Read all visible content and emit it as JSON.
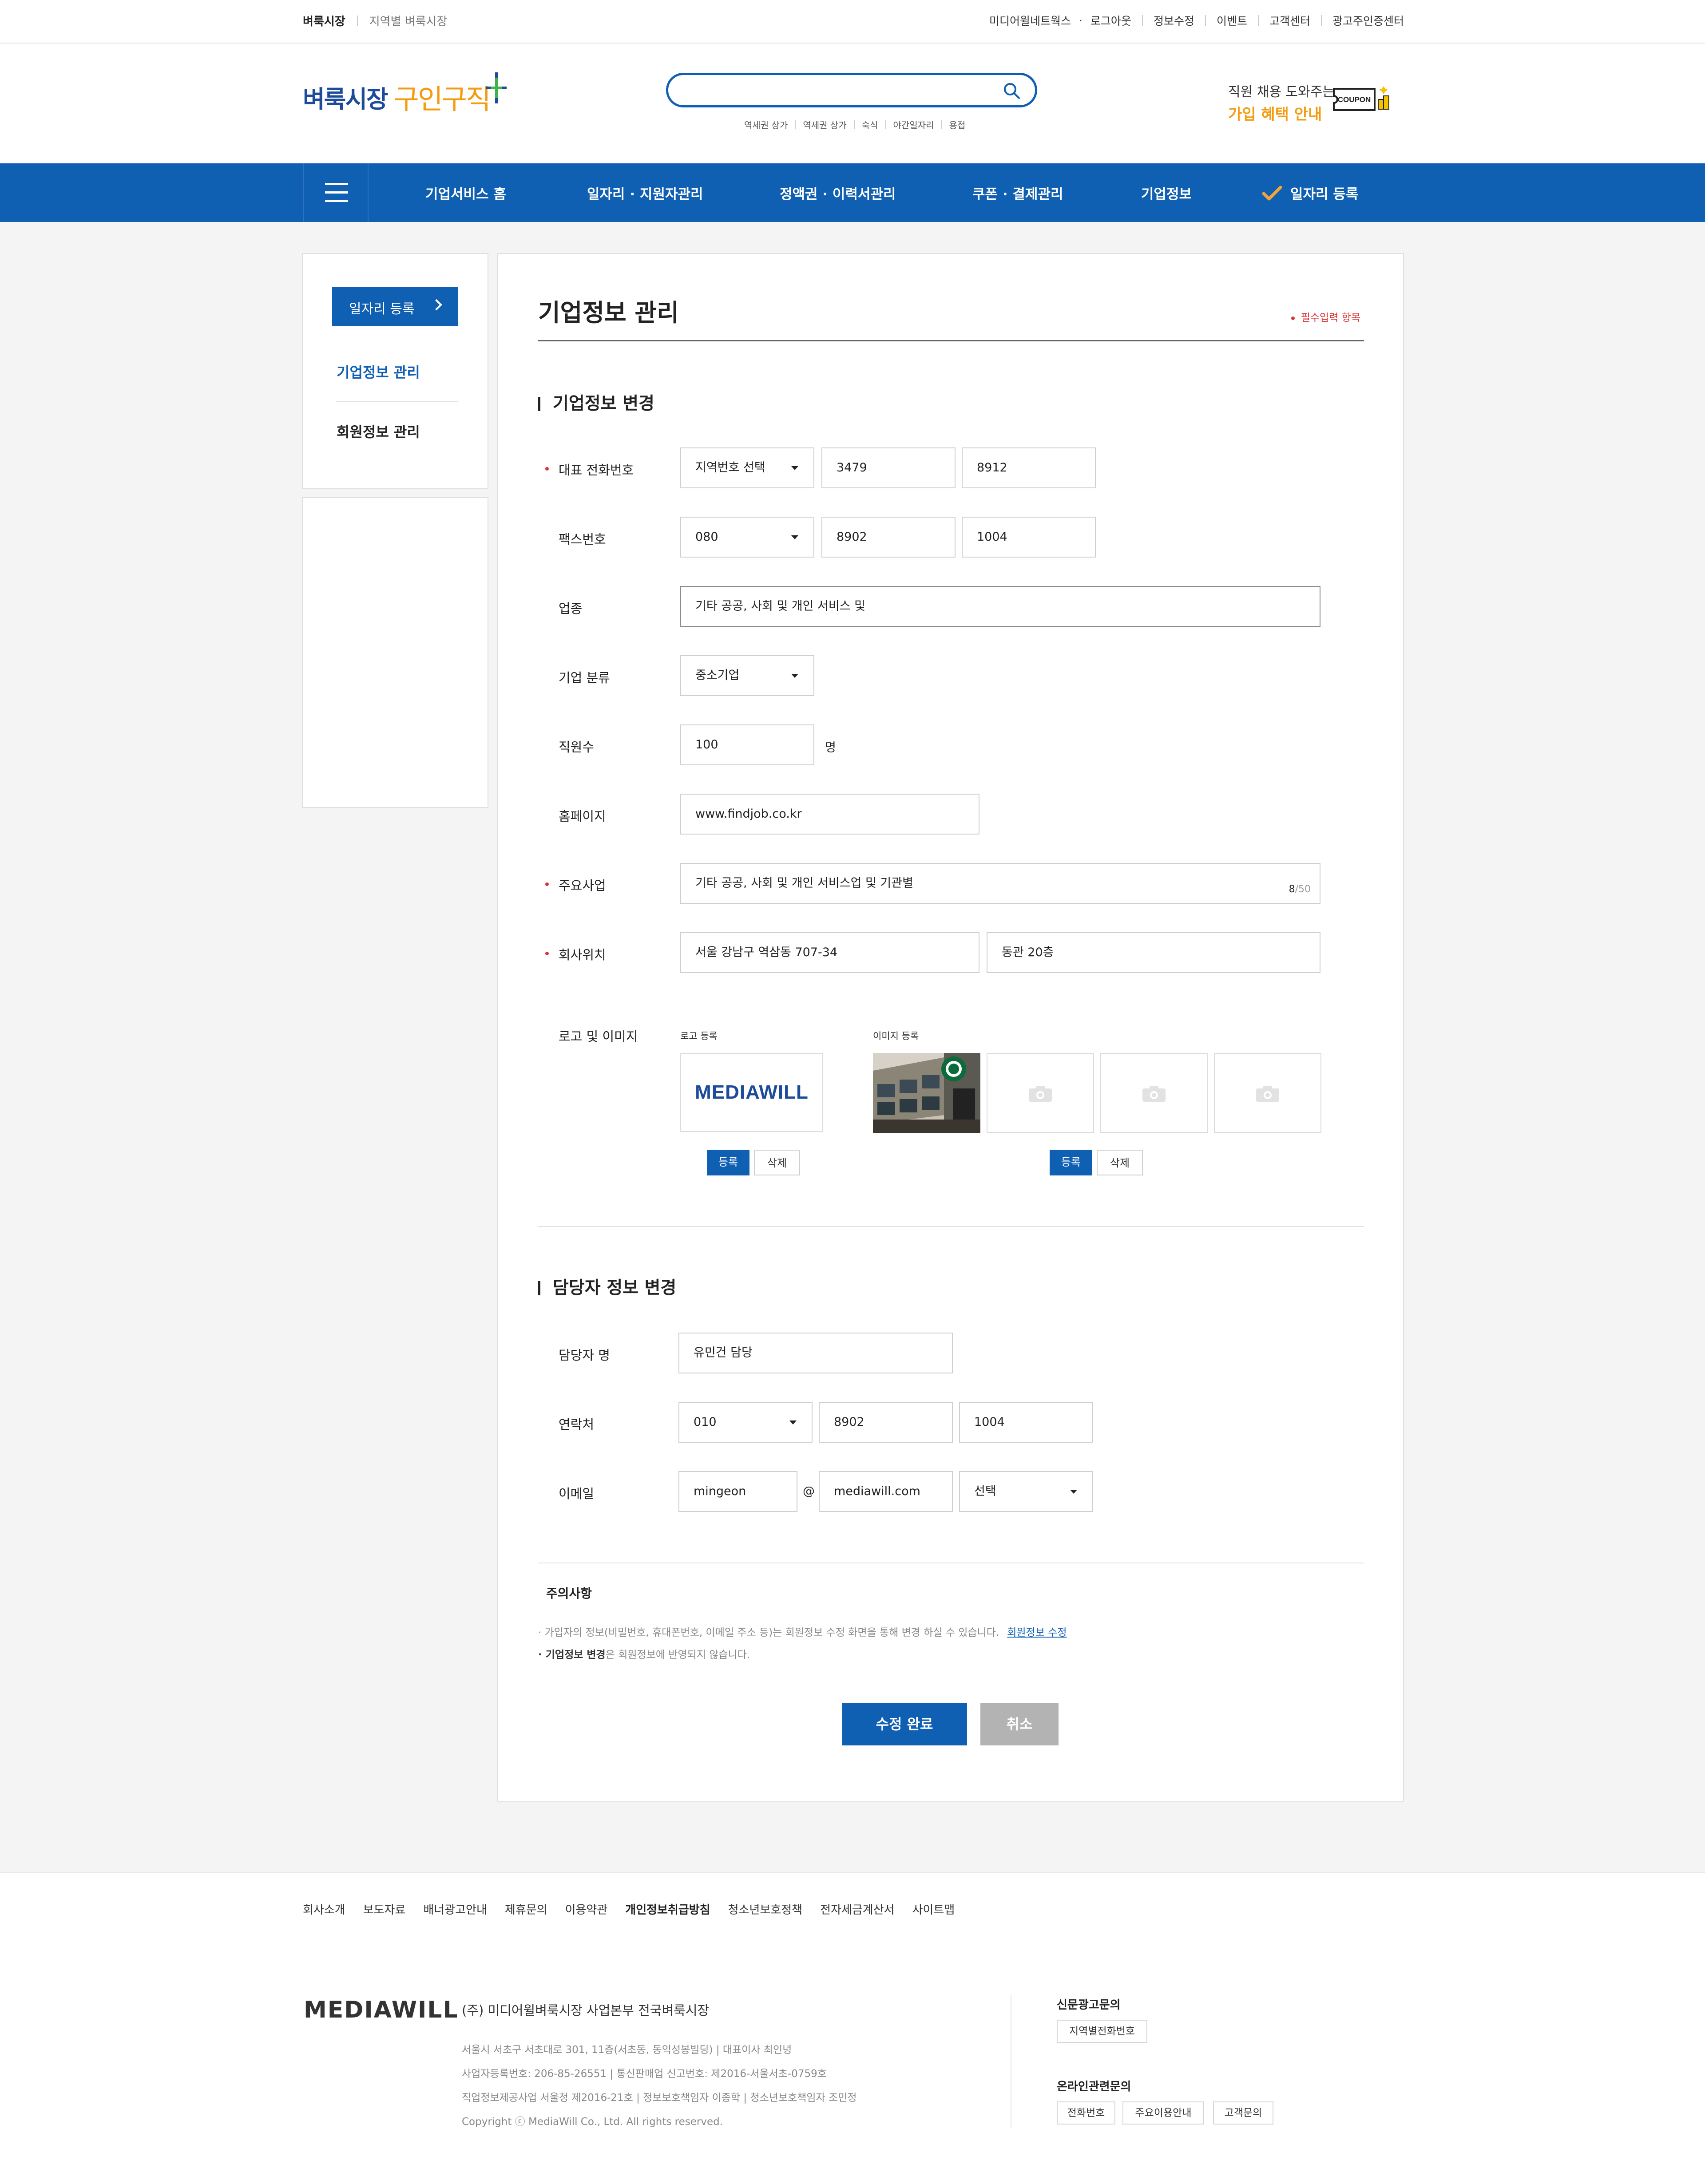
{
  "topbar": {
    "current": "벼룩시장",
    "regional": "지역별 벼룩시장",
    "links": [
      "미디어윌네트웍스",
      "로그아웃",
      "정보수정",
      "이벤트",
      "고객센터",
      "광고주인증센터"
    ]
  },
  "header": {
    "logo_main": "벼룩시장",
    "logo_sub": "구인구직",
    "search_placeholder": "",
    "keywords": [
      "역세권 상가",
      "역세권 상가",
      "숙식",
      "야간일자리",
      "용접"
    ],
    "promo_line1": "직원 채용 도와주는",
    "promo_line2": "가입 혜택 안내",
    "coupon_label": "COUPON"
  },
  "nav": {
    "items": [
      "기업서비스 홈",
      "일자리 · 지원자관리",
      "정액권 · 이력서관리",
      "쿠폰 · 결제관리",
      "기업정보",
      "일자리 등록"
    ]
  },
  "sidebar": {
    "register_button": "일자리 등록",
    "items": [
      "기업정보 관리",
      "회원정보 관리"
    ]
  },
  "page": {
    "title": "기업정보 관리",
    "required_note": "필수입력 항목"
  },
  "company_section": {
    "title": "기업정보 변경",
    "phone_label": "대표 전화번호",
    "phone": [
      "지역번호 선택",
      "3479",
      "8912"
    ],
    "fax_label": "팩스번호",
    "fax": [
      "080",
      "8902",
      "1004"
    ],
    "industry_label": "업종",
    "industry": "기타 공공, 사회 및 개인 서비스 및",
    "category_label": "기업 분류",
    "category": "중소기업",
    "employees_label": "직원수",
    "employees": "100",
    "employees_unit": "명",
    "homepage_label": "홈페이지",
    "homepage": "www.findjob.co.kr",
    "business_label": "주요사업",
    "business": "기타 공공, 사회 및 개인 서비스업 및 기관별",
    "business_count": "8",
    "business_max": "/50",
    "location_label": "회사위치",
    "address": "서울 강남구 역삼동 707-34",
    "address_detail": "동관 20층",
    "logo_image_label": "로고 및 이미지",
    "logo_register_label": "로고 등록",
    "image_register_label": "이미지 등록",
    "logo_text": "MEDIAWILL",
    "register_button": "등록",
    "delete_button": "삭제"
  },
  "contact_section": {
    "title": "담당자 정보 변경",
    "manager_label": "담당자 명",
    "manager": "유민건 담당",
    "phone_label": "연락처",
    "phone": [
      "010",
      "8902",
      "1004"
    ],
    "email_label": "이메일",
    "email_id": "mingeon",
    "email_at": "@",
    "email_domain": "mediawill.com",
    "email_select": "선택"
  },
  "notice": {
    "title": "주의사항",
    "line1": "· 가입자의 정보(비밀번호, 휴대폰번호, 이메일 주소 등)는 회원정보 수정 화면을 통해 변경 하실 수 있습니다.",
    "line1_link": "회원정보 수정",
    "line2_bold": "· 기업정보 변경",
    "line2_rest": "은 회원정보에 반영되지 않습니다."
  },
  "actions": {
    "submit": "수정 완료",
    "cancel": "취소"
  },
  "footer": {
    "links": [
      "회사소개",
      "보도자료",
      "배너광고안내",
      "제휴문의",
      "이용약관",
      "개인정보취급방침",
      "청소년보호정책",
      "전자세금계산서",
      "사이트맵"
    ],
    "logo": "MEDIAWILL",
    "company": "(주) 미디어윌벼룩시장 사업본부 전국벼룩시장",
    "info": [
      "서울시 서초구 서초대로 301, 11층(서초동, 동익성봉빌딩)  |  대표이사 최인녕",
      "사업자등록번호: 206-85-26551  |  통신판매업 신고번호: 제2016-서울서초-0759호",
      "직업정보제공사업 서울청 제2016-21호  |  정보보호책임자 이종학  |  청소년보호책임자 조민정",
      "Copyright ⓒ MediaWill Co., Ltd. All rights reserved."
    ],
    "newspaper_ad": "신문광고문의",
    "newspaper_btn": "지역별전화번호",
    "online_ad": "온라인관련문의",
    "online_btns": [
      "전화번호",
      "주요이용안내",
      "고객문의"
    ]
  },
  "colors": {
    "brand_blue": "#0f5fb3",
    "accent_orange": "#f39c12",
    "required_red": "#e03333"
  }
}
